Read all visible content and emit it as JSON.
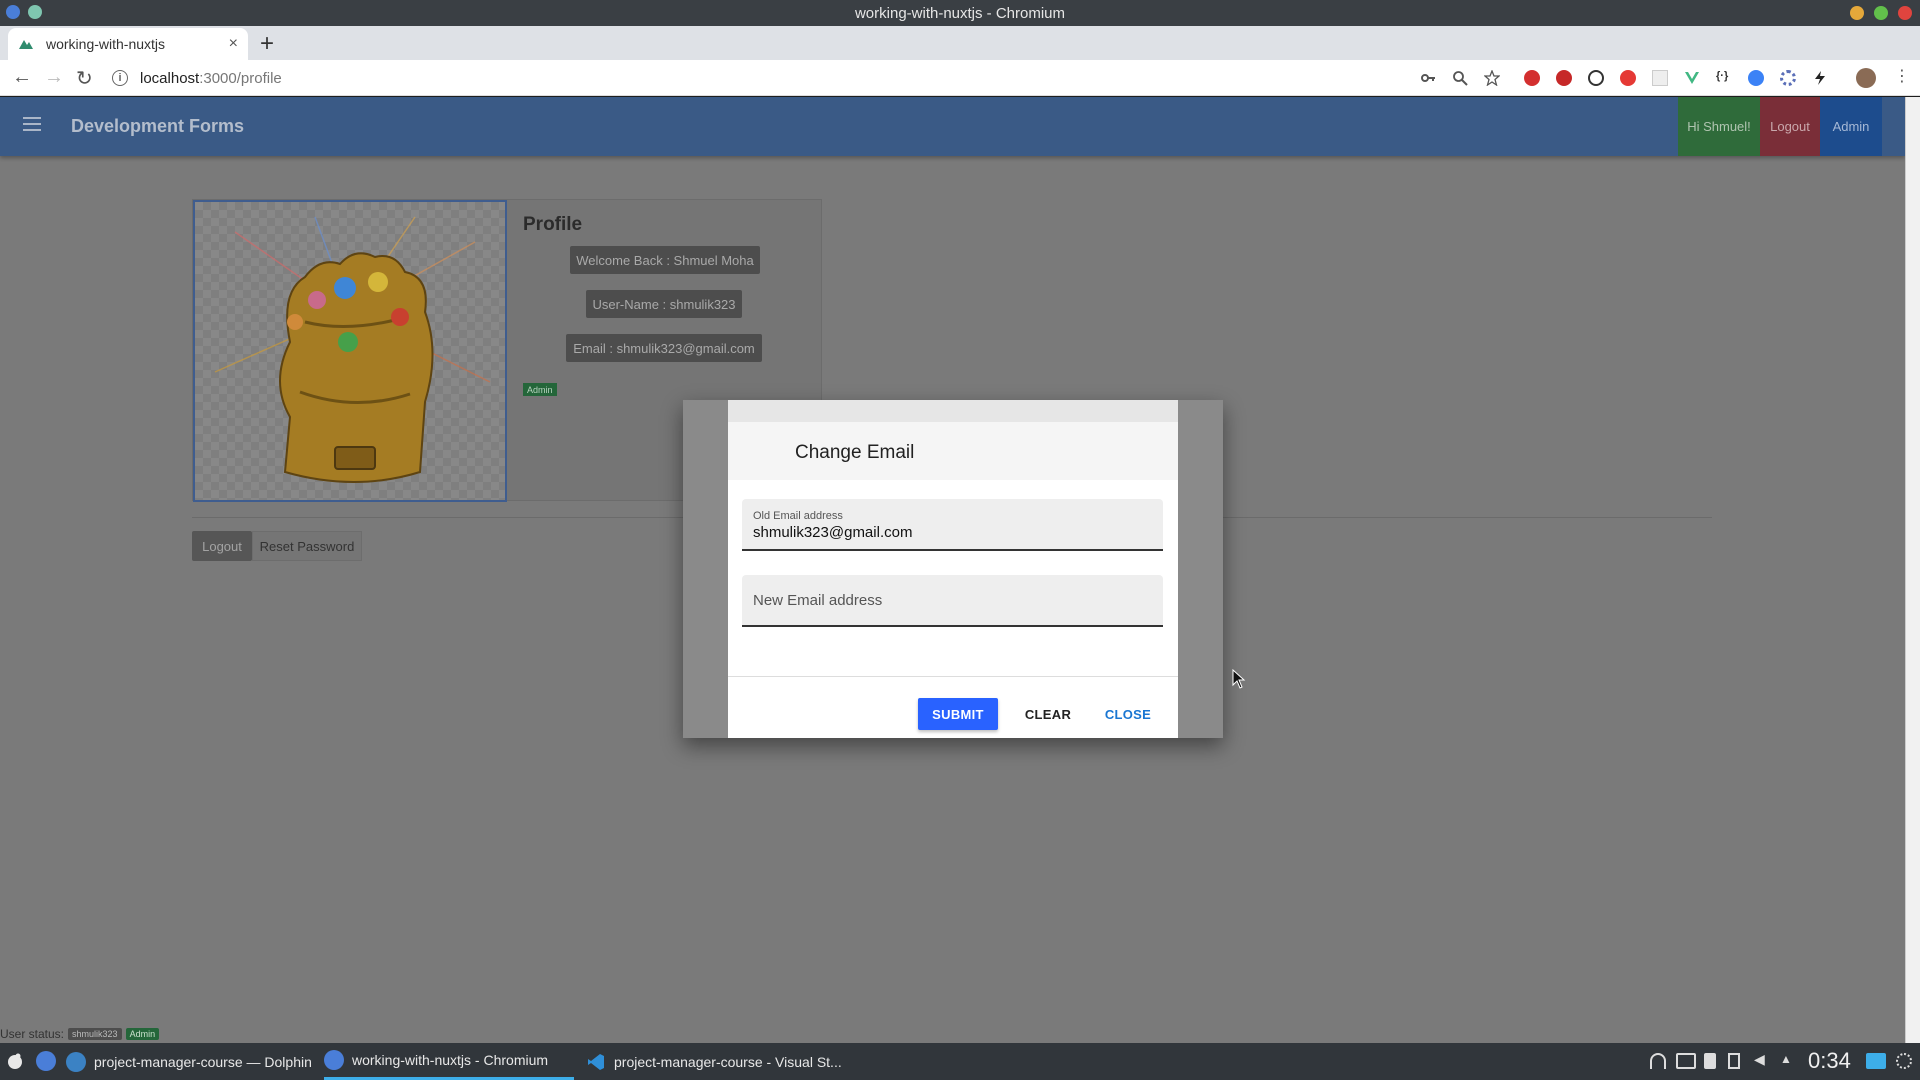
{
  "window": {
    "title": "working-with-nuxtjs - Chromium"
  },
  "browser": {
    "tab_title": "working-with-nuxtjs",
    "tab_close": "×",
    "new_tab": "+",
    "url_host": "localhost",
    "url_path": ":3000/profile"
  },
  "app": {
    "title": "Development Forms",
    "greeting": "Hi Shmuel!",
    "logout_label": "Logout",
    "admin_label": "Admin",
    "colors": {
      "appbar": "#3a5a86",
      "greeting_bg": "#2f6b3a",
      "logout_bg": "#7a2e38",
      "admin_bg": "#1d4c8d"
    }
  },
  "profile": {
    "heading": "Profile",
    "welcome": "Welcome Back : Shmuel Moha",
    "username": "User-Name : shmulik323",
    "email": "Email : shmulik323@gmail.com",
    "role_badge": "Admin",
    "logout_button": "Logout",
    "reset_password_button": "Reset Password"
  },
  "status": {
    "label": "User status:",
    "username": "shmulik323",
    "role": "Admin"
  },
  "dialog": {
    "title": "Change Email",
    "old_email_label": "Old Email address",
    "old_email_value": "shmulik323@gmail.com",
    "new_email_placeholder": "New Email address",
    "submit_label": "SUBMIT",
    "clear_label": "CLEAR",
    "close_label": "CLOSE",
    "colors": {
      "submit": "#2962ff",
      "close": "#1976d2"
    }
  },
  "taskbar": {
    "items": [
      {
        "label": "project-manager-course — Dolphin"
      },
      {
        "label": "working-with-nuxtjs - Chromium"
      },
      {
        "label": "project-manager-course - Visual St..."
      }
    ],
    "clock": "0:34"
  }
}
